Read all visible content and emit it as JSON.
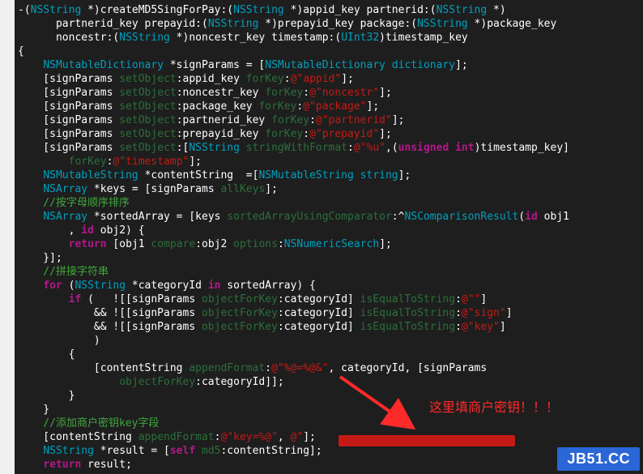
{
  "code": {
    "line01_a": "-(",
    "line01_b": "NSString",
    "line01_c": " *)createMD5SingForPay:(",
    "line01_d": "NSString",
    "line01_e": " *)appid_key partnerid:(",
    "line01_f": "NSString",
    "line01_g": " *)",
    "line02_a": "      partnerid_key prepayid:(",
    "line02_b": "NSString",
    "line02_c": " *)prepayid_key package:(",
    "line02_d": "NSString",
    "line02_e": " *)package_key",
    "line03_a": "      noncestr:(",
    "line03_b": "NSString",
    "line03_c": " *)noncestr_key timestamp:(",
    "line03_d": "UInt32",
    "line03_e": ")timestamp_key",
    "line04": "{",
    "line05_a": "    ",
    "line05_b": "NSMutableDictionary",
    "line05_c": " *signParams = [",
    "line05_d": "NSMutableDictionary",
    "line05_e": " ",
    "line05_f": "dictionary",
    "line05_g": "];",
    "line06_a": "    [signParams ",
    "line06_b": "setObject",
    "line06_c": ":appid_key ",
    "line06_d": "forKey",
    "line06_e": ":",
    "line06_f": "@\"appid\"",
    "line06_g": "];",
    "line07_a": "    [signParams ",
    "line07_b": "setObject",
    "line07_c": ":noncestr_key ",
    "line07_d": "forKey",
    "line07_e": ":",
    "line07_f": "@\"noncestr\"",
    "line07_g": "];",
    "line08_a": "    [signParams ",
    "line08_b": "setObject",
    "line08_c": ":package_key ",
    "line08_d": "forKey",
    "line08_e": ":",
    "line08_f": "@\"package\"",
    "line08_g": "];",
    "line09_a": "    [signParams ",
    "line09_b": "setObject",
    "line09_c": ":partnerid_key ",
    "line09_d": "forKey",
    "line09_e": ":",
    "line09_f": "@\"partnerid\"",
    "line09_g": "];",
    "line10_a": "    [signParams ",
    "line10_b": "setObject",
    "line10_c": ":prepayid_key ",
    "line10_d": "forKey",
    "line10_e": ":",
    "line10_f": "@\"prepayid\"",
    "line10_g": "];",
    "line11_a": "    [signParams ",
    "line11_b": "setObject",
    "line11_c": ":[",
    "line11_d": "NSString",
    "line11_e": " ",
    "line11_f": "stringWithFormat",
    "line11_g": ":",
    "line11_h": "@\"%u\"",
    "line11_i": ",(",
    "line11_j": "unsigned",
    "line11_k": " ",
    "line11_l": "int",
    "line11_m": ")timestamp_key]",
    "line12_a": "        ",
    "line12_b": "forKey",
    "line12_c": ":",
    "line12_d": "@\"timestamp\"",
    "line12_e": "];",
    "line13_a": "    ",
    "line13_b": "NSMutableString",
    "line13_c": " *contentString  =[",
    "line13_d": "NSMutableString",
    "line13_e": " ",
    "line13_f": "string",
    "line13_g": "];",
    "line14_a": "    ",
    "line14_b": "NSArray",
    "line14_c": " *keys = [signParams ",
    "line14_d": "allKeys",
    "line14_e": "];",
    "line15": "    //按字母顺序排序",
    "line16_a": "    ",
    "line16_b": "NSArray",
    "line16_c": " *sortedArray = [keys ",
    "line16_d": "sortedArrayUsingComparator",
    "line16_e": ":^",
    "line16_f": "NSComparisonResult",
    "line16_g": "(",
    "line16_h": "id",
    "line16_i": " obj1",
    "line17_a": "        , ",
    "line17_b": "id",
    "line17_c": " obj2) {",
    "line18_a": "        ",
    "line18_b": "return",
    "line18_c": " [obj1 ",
    "line18_d": "compare",
    "line18_e": ":obj2 ",
    "line18_f": "options",
    "line18_g": ":",
    "line18_h": "NSNumericSearch",
    "line18_i": "];",
    "line19": "    }];",
    "line20": "    //拼接字符串",
    "line21_a": "    ",
    "line21_b": "for",
    "line21_c": " (",
    "line21_d": "NSString",
    "line21_e": " *categoryId ",
    "line21_f": "in",
    "line21_g": " sortedArray) {",
    "line22_a": "        ",
    "line22_b": "if",
    "line22_c": " (   ![[signParams ",
    "line22_d": "objectForKey",
    "line22_e": ":categoryId] ",
    "line22_f": "isEqualToString",
    "line22_g": ":",
    "line22_h": "@\"\"",
    "line22_i": "]",
    "line23_a": "            && ![[signParams ",
    "line23_b": "objectForKey",
    "line23_c": ":categoryId] ",
    "line23_d": "isEqualToString",
    "line23_e": ":",
    "line23_f": "@\"sign\"",
    "line23_g": "]",
    "line24_a": "            && ![[signParams ",
    "line24_b": "objectForKey",
    "line24_c": ":categoryId] ",
    "line24_d": "isEqualToString",
    "line24_e": ":",
    "line24_f": "@\"key\"",
    "line24_g": "]",
    "line25": "            )",
    "line26": "        {",
    "line27_a": "            [contentString ",
    "line27_b": "appendFormat",
    "line27_c": ":",
    "line27_d": "@\"%@=%@&\"",
    "line27_e": ", categoryId, [signParams",
    "line28_a": "                ",
    "line28_b": "objectForKey",
    "line28_c": ":categoryId]];",
    "line29": "        }",
    "line30": "    }",
    "line31": "    //添加商户密钥key字段",
    "line32_a": "    [contentString ",
    "line32_b": "appendFormat",
    "line32_c": ":",
    "line32_d": "@\"key=%@\"",
    "line32_e": ", ",
    "line32_f": "@\"",
    "line32_g": "];",
    "line33_a": "    ",
    "line33_b": "NSString",
    "line33_c": " *result = [",
    "line33_d": "self",
    "line33_e": " ",
    "line33_f": "md5",
    "line33_g": ":contentString];",
    "line34_a": "    ",
    "line34_b": "return",
    "line34_c": " result;"
  },
  "annotation": "这里填商户密钥！！！",
  "watermark": "JB51.CC"
}
